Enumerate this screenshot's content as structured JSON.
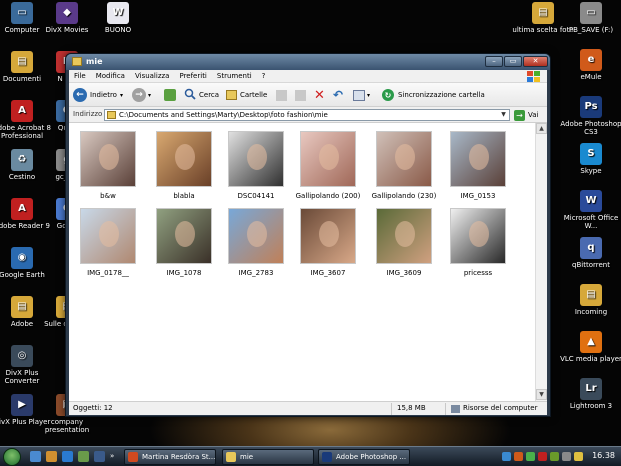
{
  "desktop": {
    "left_icons": [
      {
        "label": "Computer",
        "color": "#3a6a9a",
        "glyph": "▭"
      },
      {
        "label": "Documenti",
        "color": "#d6a83a",
        "glyph": "▤"
      },
      {
        "label": "Adobe Acrobat 8 Professional",
        "color": "#c02020",
        "glyph": "A"
      },
      {
        "label": "Cestino",
        "color": "#6a8aa0",
        "glyph": "♻"
      },
      {
        "label": "Adobe Reader 9",
        "color": "#c02020",
        "glyph": "A"
      },
      {
        "label": "Google Earth",
        "color": "#2a6ab0",
        "glyph": "◉"
      },
      {
        "label": "Adobe",
        "color": "#d6a83a",
        "glyph": "▤"
      },
      {
        "label": "DivX Plus Converter",
        "color": "#3a4a5a",
        "glyph": "◎"
      },
      {
        "label": "DivX Plus Player",
        "color": "#2a3a6a",
        "glyph": "▶"
      }
    ],
    "second_icons": [
      {
        "label": "DivX Movies",
        "color": "#5a3a8a",
        "glyph": "◆"
      },
      {
        "label": "N Sta",
        "color": "#c03030",
        "glyph": "N"
      },
      {
        "label": "Qu Pl",
        "color": "#3a6aa0",
        "glyph": "Q"
      },
      {
        "label": "gc_wO",
        "color": "#8a8a8a",
        "glyph": "g"
      },
      {
        "label": "Googl",
        "color": "#4a7ad0",
        "glyph": "G"
      },
      {
        "label": "Sulle o carità",
        "color": "#d6a83a",
        "glyph": "▤"
      },
      {
        "label": "company presentation",
        "color": "#8a4a2a",
        "glyph": "▣"
      }
    ],
    "third_icons": [
      {
        "label": "BUONO",
        "color": "#e8e8f0",
        "glyph": "W"
      }
    ],
    "right_icons_a": [
      {
        "label": "ultima scelta foto",
        "color": "#d6a83a",
        "glyph": "▤"
      }
    ],
    "right_icons_b": [
      {
        "label": "PB_SAVE (F:)",
        "color": "#8a8a8a",
        "glyph": "▭"
      },
      {
        "label": "eMule",
        "color": "#d05a1a",
        "glyph": "e"
      },
      {
        "label": "Adobe Photoshop CS3",
        "color": "#1a3a7a",
        "glyph": "Ps"
      },
      {
        "label": "Skype",
        "color": "#1a8ad0",
        "glyph": "S"
      },
      {
        "label": "Microsoft Office W...",
        "color": "#2a4a9a",
        "glyph": "W"
      },
      {
        "label": "qBittorrent",
        "color": "#4a6ab0",
        "glyph": "q"
      },
      {
        "label": "Incoming",
        "color": "#d6a83a",
        "glyph": "▤"
      },
      {
        "label": "VLC media player",
        "color": "#e07010",
        "glyph": "▲"
      },
      {
        "label": "Lightroom 3",
        "color": "#3a4a5a",
        "glyph": "Lr"
      }
    ]
  },
  "window": {
    "title": "mie",
    "menu": [
      "File",
      "Modifica",
      "Visualizza",
      "Preferiti",
      "Strumenti",
      "?"
    ],
    "toolbar": {
      "back_label": "Indietro",
      "search_label": "Cerca",
      "folders_label": "Cartelle",
      "sync_label": "Sincronizzazione cartella"
    },
    "address": {
      "label": "Indirizzo",
      "value": "C:\\Documents and Settings\\Marty\\Desktop\\foto fashion\\mie",
      "go_label": "Vai"
    },
    "thumbnails": [
      {
        "caption": "b&w",
        "c1": "#d8c8c0",
        "c2": "#5a4038"
      },
      {
        "caption": "blabla",
        "c1": "#d8a870",
        "c2": "#6a4028"
      },
      {
        "caption": "DSC04141",
        "c1": "#e0e0e0",
        "c2": "#303030"
      },
      {
        "caption": "Gallipolando (200)",
        "c1": "#e8c8c0",
        "c2": "#a06858"
      },
      {
        "caption": "Gallipolando (230)",
        "c1": "#d0c0b8",
        "c2": "#8a5a48"
      },
      {
        "caption": "IMG_0153",
        "c1": "#a8b8c8",
        "c2": "#5a4038"
      },
      {
        "caption": "IMG_0178__",
        "c1": "#c8d8e8",
        "c2": "#b08870"
      },
      {
        "caption": "IMG_1078",
        "c1": "#90a080",
        "c2": "#3a3028"
      },
      {
        "caption": "IMG_2783",
        "c1": "#78a8d8",
        "c2": "#c08058"
      },
      {
        "caption": "IMG_3607",
        "c1": "#6a4a38",
        "c2": "#d8a888"
      },
      {
        "caption": "IMG_3609",
        "c1": "#5a6a38",
        "c2": "#d0a080"
      },
      {
        "caption": "pricesss",
        "c1": "#f0f0f0",
        "c2": "#282828"
      }
    ],
    "status": {
      "objects": "Oggetti: 12",
      "size": "15,8 MB",
      "location": "Risorse del computer"
    }
  },
  "taskbar": {
    "tasks": [
      {
        "label": "Martina Resdòra St...",
        "color": "#d04a20"
      },
      {
        "label": "mie",
        "color": "#e8c85a"
      },
      {
        "label": "Adobe Photoshop ...",
        "color": "#1a3a7a"
      }
    ],
    "clock": "16.38"
  }
}
